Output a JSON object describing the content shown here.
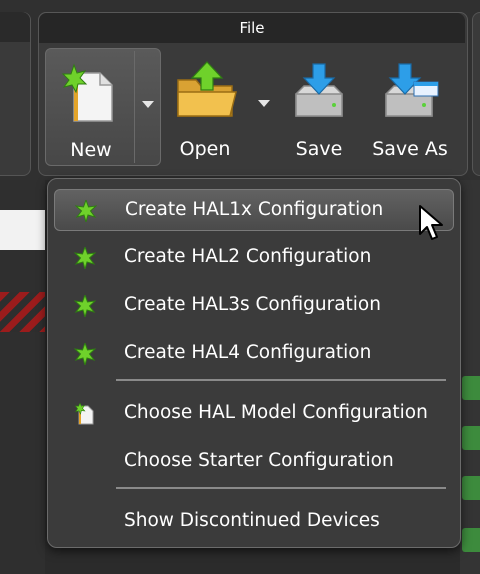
{
  "ribbon": {
    "group_title": "File",
    "buttons": {
      "new": "New",
      "open": "Open",
      "save": "Save",
      "save_as": "Save As"
    }
  },
  "menu": {
    "items": [
      {
        "label": "Create HAL1x Configuration",
        "icon": "green-star-icon",
        "selected": true
      },
      {
        "label": "Create HAL2 Configuration",
        "icon": "green-star-icon"
      },
      {
        "label": "Create HAL3s Configuration",
        "icon": "green-star-icon"
      },
      {
        "label": "Create HAL4 Configuration",
        "icon": "green-star-icon"
      },
      {
        "label": "Choose HAL Model Configuration",
        "icon": "new-document-icon"
      },
      {
        "label": "Choose Starter Configuration",
        "icon": ""
      },
      {
        "label": "Show Discontinued Devices",
        "icon": ""
      }
    ]
  },
  "colors": {
    "accent_green": "#6fd12b",
    "ribbon_bg": "#3a3a3a",
    "menu_bg": "#3b3b3b"
  }
}
